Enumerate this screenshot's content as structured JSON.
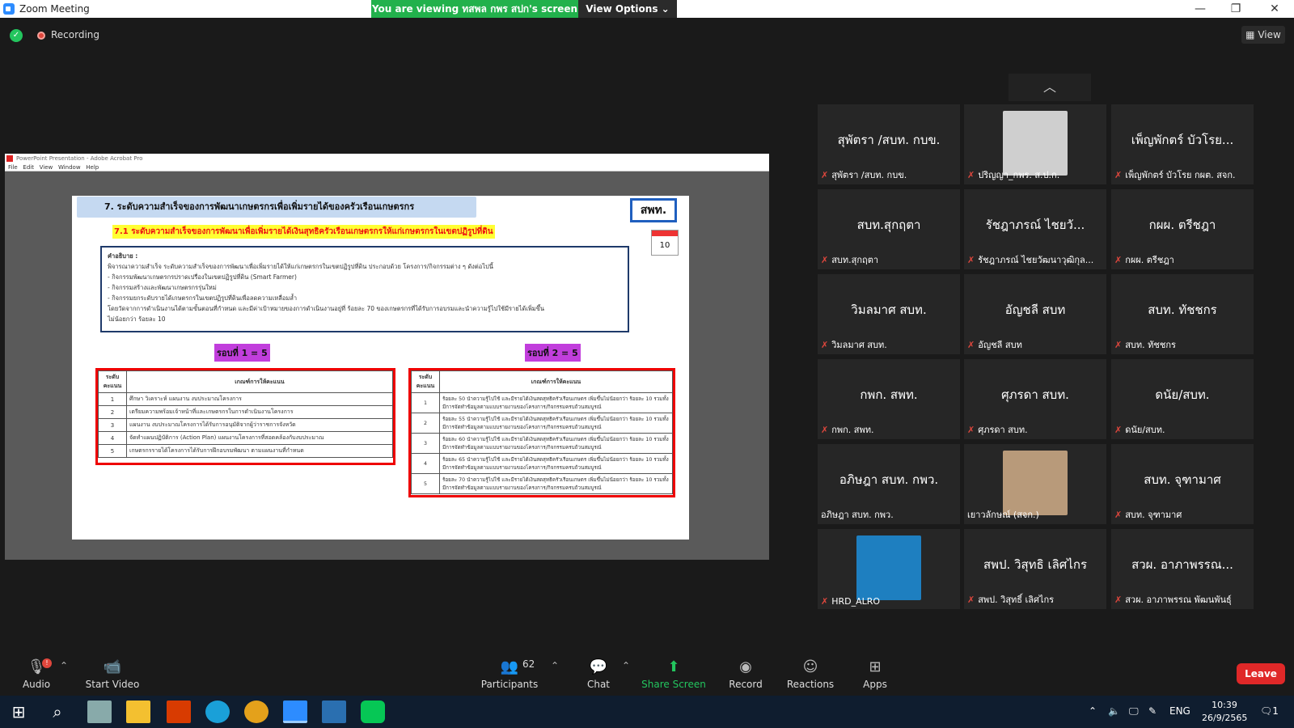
{
  "window": {
    "title": "Zoom Meeting",
    "minimize": "—",
    "maximize": "❐",
    "close": "✕"
  },
  "banner": {
    "viewing": "You are viewing ทสพล กพร สปก's screen",
    "view_options": "View Options ⌄"
  },
  "status": {
    "recording": "Recording",
    "view": "View",
    "shield": "✓"
  },
  "shared_app": {
    "title": "PowerPoint Presentation - Adobe Acrobat Pro",
    "menu": [
      "File",
      "Edit",
      "View",
      "Window",
      "Help"
    ]
  },
  "slide": {
    "heading": "7. ระดับความสำเร็จของการพัฒนาเกษตรกรเพื่อเพิ่มรายได้ของครัวเรือนเกษตรกร",
    "tag": "สพท.",
    "calendar_day": "10",
    "subheading": "7.1 ระดับความสำเร็จของการพัฒนาเพื่อเพิ่มรายได้เงินสุทธิครัวเรือนเกษตรกรให้แก่เกษตรกรในเขตปฏิรูปที่ดิน",
    "definition_lines": [
      "คำอธิบาย :",
      "พิจารณาความสำเร็จ ระดับความสำเร็จของการพัฒนาเพื่อเพิ่มรายได้ให้แก่เกษตรกรในเขตปฏิรูปที่ดิน ประกอบด้วย โครงการ/กิจกรรมต่าง ๆ ดังต่อไปนี้",
      "- กิจกรรมพัฒนาเกษตรกรปราดเปรื่องในเขตปฏิรูปที่ดิน (Smart Farmer)",
      "- กิจกรรมสร้างและพัฒนาเกษตรกรรุ่นใหม่",
      "- กิจกรรมยกระดับรายได้เกษตรกรในเขตปฏิรูปที่ดินเพื่อลดความเหลื่อมล้ำ",
      "โดยวัดจากการดำเนินงานได้ตามขั้นตอนที่กำหนด และมีค่าเป้าหมายของการดำเนินงานอยู่ที่ ร้อยละ 70 ของเกษตรกรที่ได้รับการอบรมและนำความรู้ไปใช้มีรายได้เพิ่มขึ้น",
      "ไม่น้อยกว่า ร้อยละ 10"
    ],
    "round1": "รอบที่ 1 = 5",
    "round2": "รอบที่ 2 = 5",
    "table_headers": [
      "ระดับคะแนน",
      "เกณฑ์การให้คะแนน"
    ],
    "table1": [
      [
        "1",
        "ศึกษา วิเคราะห์ แผนงาน งบประมาณโครงการ"
      ],
      [
        "2",
        "เตรียมความพร้อมเจ้าหน้าที่และเกษตรกรในการดำเนินงานโครงการ"
      ],
      [
        "3",
        "แผนงาน งบประมาณโครงการได้รับการอนุมัติจากผู้ว่าราชการจังหวัด"
      ],
      [
        "4",
        "จัดทำแผนปฏิบัติการ (Action Plan) แผนงานโครงการที่สอดคล้องกับงบประมาณ"
      ],
      [
        "5",
        "เกษตรกรรายได้โครงการได้รับการฝึกอบรมพัฒนา ตามแผนงานที่กำหนด"
      ]
    ],
    "table2": [
      [
        "1",
        "ร้อยละ 50 นำความรู้ไปใช้ และมีรายได้เงินสดสุทธิครัวเรือนเกษตร เพิ่มขึ้นไม่น้อยกว่า ร้อยละ 10 รวมทั้งมีการจัดทำข้อมูลตามแบบรายงานของโครงการ/กิจกรรมครบถ้วนสมบูรณ์"
      ],
      [
        "2",
        "ร้อยละ 55 นำความรู้ไปใช้ และมีรายได้เงินสดสุทธิครัวเรือนเกษตร เพิ่มขึ้นไม่น้อยกว่า ร้อยละ 10 รวมทั้งมีการจัดทำข้อมูลตามแบบรายงานของโครงการ/กิจกรรมครบถ้วนสมบูรณ์"
      ],
      [
        "3",
        "ร้อยละ 60 นำความรู้ไปใช้ และมีรายได้เงินสดสุทธิครัวเรือนเกษตร เพิ่มขึ้นไม่น้อยกว่า ร้อยละ 10 รวมทั้งมีการจัดทำข้อมูลตามแบบรายงานของโครงการ/กิจกรรมครบถ้วนสมบูรณ์"
      ],
      [
        "4",
        "ร้อยละ 65 นำความรู้ไปใช้ และมีรายได้เงินสดสุทธิครัวเรือนเกษตร เพิ่มขึ้นไม่น้อยกว่า ร้อยละ 10 รวมทั้งมีการจัดทำข้อมูลตามแบบรายงานของโครงการ/กิจกรรมครบถ้วนสมบูรณ์"
      ],
      [
        "5",
        "ร้อยละ 70 นำความรู้ไปใช้ และมีรายได้เงินสดสุทธิครัวเรือนเกษตร เพิ่มขึ้นไม่น้อยกว่า ร้อยละ 10 รวมทั้งมีการจัดทำข้อมูลตามแบบรายงานของโครงการ/กิจกรรมครบถ้วนสมบูรณ์"
      ]
    ]
  },
  "gallery": {
    "scroll_up": "︿",
    "tiles": [
      {
        "name": "สุพัตรา /สบท. กบข.",
        "label": "สุพัตรา /สบท. กบข.",
        "muted": true,
        "avatar": null
      },
      {
        "name": "",
        "label": "ปริญญา_กพร. ส.ป.ก.",
        "muted": true,
        "avatar": "cartoon"
      },
      {
        "name": "เพ็ญพักตร์ บัวโรย...",
        "label": "เพ็ญพักตร์ บัวโรย กผต. สจก.",
        "muted": true,
        "avatar": null
      },
      {
        "name": "สบท.สุกฤตา",
        "label": "สบท.สุกฤตา",
        "muted": true,
        "avatar": null
      },
      {
        "name": "รัชฎาภรณ์ ไชยวั...",
        "label": "รัชฎาภรณ์ ไชยวัฒนาวุฒิกุล...",
        "muted": true,
        "avatar": null
      },
      {
        "name": "กผผ. ตรีชฎา",
        "label": "กผผ. ตรีชฎา",
        "muted": true,
        "avatar": null
      },
      {
        "name": "วิมลมาศ สบท.",
        "label": "วิมลมาศ สบท.",
        "muted": true,
        "avatar": null
      },
      {
        "name": "อัญชลี สบท",
        "label": "อัญชลี สบท",
        "muted": true,
        "avatar": null
      },
      {
        "name": "สบท. ทัชชกร",
        "label": "สบท. ทัชชกร",
        "muted": true,
        "avatar": null
      },
      {
        "name": "กพก. สพท.",
        "label": "กพก. สพท.",
        "muted": true,
        "avatar": null
      },
      {
        "name": "ศุภรดา สบท.",
        "label": "ศุภรดา สบท.",
        "muted": true,
        "avatar": null
      },
      {
        "name": "ดนัย/สบท.",
        "label": "ดนัย/สบท.",
        "muted": true,
        "avatar": null
      },
      {
        "name": "อภิษฎา สบท. กพว.",
        "label": "อภิษฎา สบท. กพว.",
        "muted": false,
        "avatar": null
      },
      {
        "name": "",
        "label": "เยาวลักษณ์ (สจก.)",
        "muted": false,
        "avatar": "photo"
      },
      {
        "name": "สบท. จุฑามาศ",
        "label": "สบท. จุฑามาศ",
        "muted": true,
        "avatar": null
      },
      {
        "name": "",
        "label": "HRD_ALRO",
        "muted": true,
        "avatar": "logo"
      },
      {
        "name": "สพป. วิสุทธิ เลิศไกร",
        "label": "สพป. วิสุทธิ์ เลิศไกร",
        "muted": true,
        "avatar": null
      },
      {
        "name": "สวผ. อาภาพรรณ...",
        "label": "สวผ. อาภาพรรณ พัฒนพันธุ์",
        "muted": true,
        "avatar": null
      }
    ]
  },
  "toolbar": {
    "audio": "Audio",
    "audio_badge": "!",
    "start_video": "Start Video",
    "participants": "Participants",
    "participants_count": "62",
    "chat": "Chat",
    "share_screen": "Share Screen",
    "record": "Record",
    "reactions": "Reactions",
    "apps": "Apps",
    "leave": "Leave"
  },
  "taskbar": {
    "lang": "ENG",
    "time": "10:39",
    "date": "26/9/2565",
    "notifications": "1"
  },
  "colors": {
    "accent_green": "#22b14c",
    "leave_red": "#e02828",
    "share_green": "#23c55e"
  }
}
